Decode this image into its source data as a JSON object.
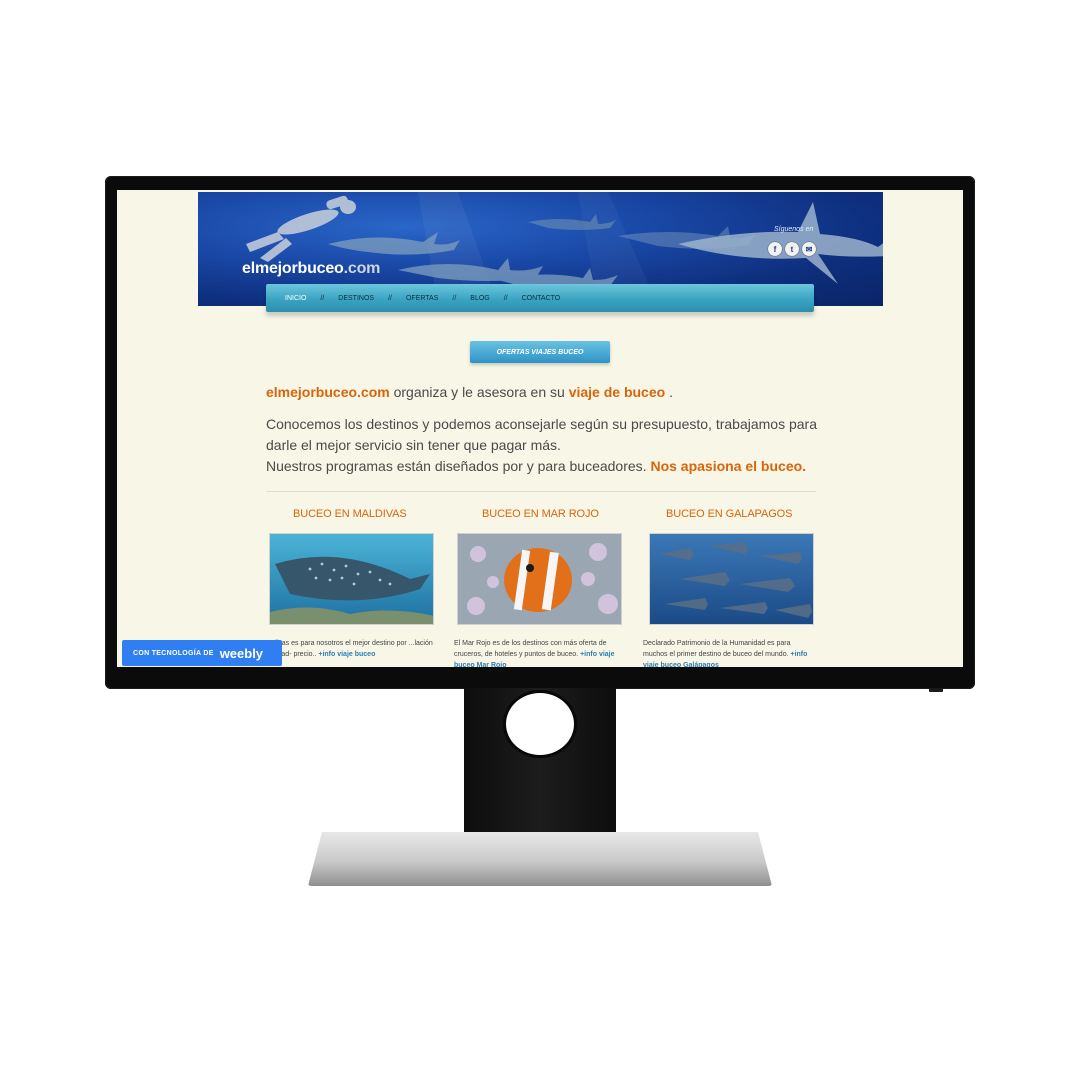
{
  "site": {
    "logo_main": "elmejorbuceo",
    "logo_tld": ".com",
    "follow_label": "Síguenos en",
    "social": [
      {
        "icon": "facebook-icon",
        "glyph": "f"
      },
      {
        "icon": "twitter-icon",
        "glyph": "t"
      },
      {
        "icon": "email-icon",
        "glyph": "✉"
      }
    ]
  },
  "nav": {
    "items": [
      "INICIO",
      "DESTINOS",
      "OFERTAS",
      "BLOG",
      "CONTACTO"
    ],
    "separator": "//",
    "active": "INICIO"
  },
  "offers_button": "OFERTAS VIAJES BUCEO",
  "intro": {
    "brand": "elmejorbuceo.com",
    "text_mid": " organiza y le asesora en su ",
    "highlight": "viaje de buceo",
    "text_end": " ."
  },
  "paragraph": {
    "line1": "Conocemos los destinos y podemos aconsejarle según su presupuesto, trabajamos para darle el mejor servicio sin tener que pagar más.",
    "line2": "Nuestros programas están diseñados por y para buceadores. ",
    "highlight": "Nos apasiona el buceo."
  },
  "destinations": [
    {
      "title": "BUCEO EN MALDIVAS",
      "text": "...divas es para nosotros el mejor destino por ...lación calidad- precio.. ",
      "more": "+info viaje buceo"
    },
    {
      "title": "BUCEO EN MAR ROJO",
      "text": "El Mar Rojo es de los destinos con más oferta de cruceros, de hoteles y puntos de buceo. ",
      "more": "+info viaje buceo Mar Rojo"
    },
    {
      "title": "BUCEO EN GALAPAGOS",
      "text": "Declarado Patrimonio de la Humanidad es para muchos el primer destino de buceo del mundo. ",
      "more": "+info viaje buceo Galápagos"
    }
  ],
  "weebly": {
    "small": "CON TECNOLOGÍA DE",
    "brand": "weebly"
  }
}
